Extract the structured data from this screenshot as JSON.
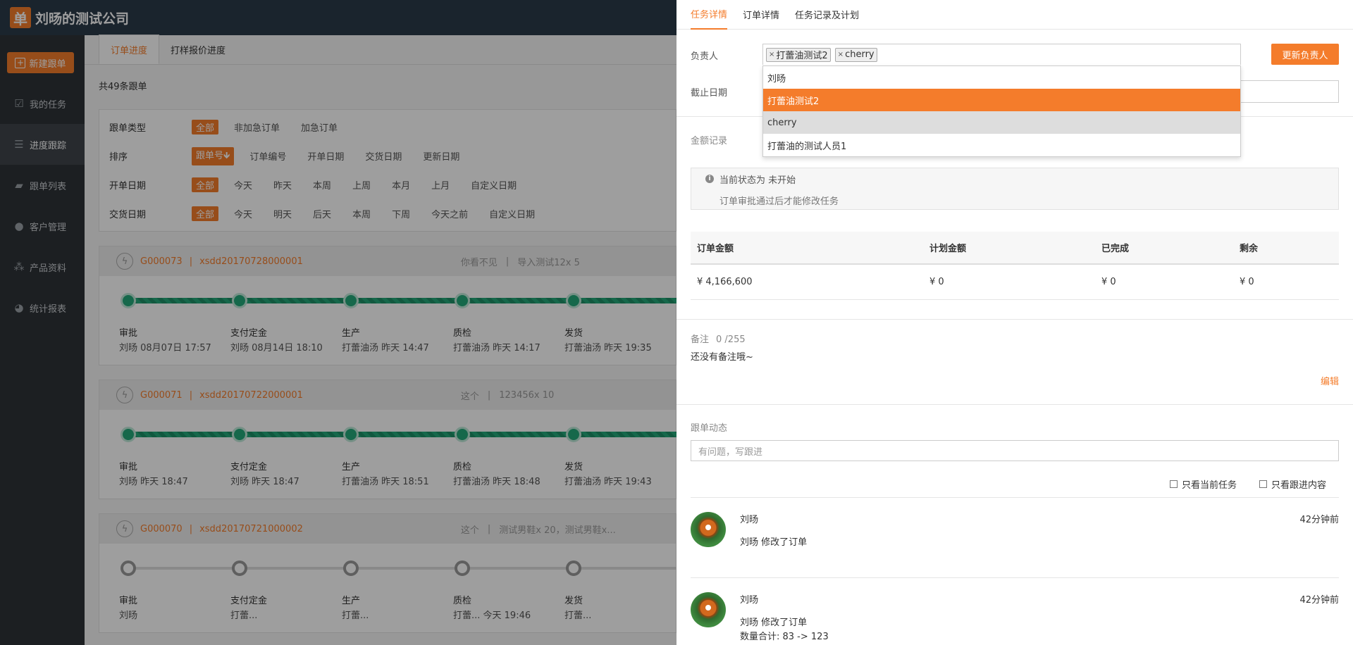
{
  "app": {
    "logo_char": "单",
    "company": "刘旸的测试公司"
  },
  "sidebar": {
    "new_button": "新建跟单",
    "items": [
      {
        "label": "我的任务",
        "icon": "check-icon"
      },
      {
        "label": "进度跟踪",
        "icon": "progress-icon",
        "active": true
      },
      {
        "label": "跟单列表",
        "icon": "folder-icon"
      },
      {
        "label": "客户管理",
        "icon": "user-icon"
      },
      {
        "label": "产品资料",
        "icon": "cubes-icon"
      },
      {
        "label": "统计报表",
        "icon": "pie-chart-icon"
      }
    ]
  },
  "main": {
    "tabs": [
      "订单进度",
      "打样报价进度"
    ],
    "count": "共49条跟单",
    "filters": [
      {
        "label": "跟单类型",
        "options": [
          "全部",
          "非加急订单",
          "加急订单"
        ]
      },
      {
        "label": "排序",
        "options": [
          "跟单号🡻",
          "订单编号",
          "开单日期",
          "交货日期",
          "更新日期"
        ]
      },
      {
        "label": "开单日期",
        "options": [
          "全部",
          "今天",
          "昨天",
          "本周",
          "上周",
          "本月",
          "上月",
          "自定义日期"
        ]
      },
      {
        "label": "交货日期",
        "options": [
          "全部",
          "今天",
          "明天",
          "后天",
          "本周",
          "下周",
          "今天之前",
          "自定义日期"
        ]
      }
    ],
    "orders": [
      {
        "id": "G000073",
        "number": "xsdd20170728000001",
        "name_a": "你看不见",
        "name_b": "导入测试12x 5",
        "done": true,
        "stages": [
          {
            "name": "审批",
            "info": "刘旸 08月07日 17:57"
          },
          {
            "name": "支付定金",
            "info": "刘旸 08月14日 18:10"
          },
          {
            "name": "生产",
            "info": "打蕾油汤 昨天 14:47"
          },
          {
            "name": "质检",
            "info": "打蕾油汤 昨天 14:17"
          },
          {
            "name": "发货",
            "info": "打蕾油汤 昨天 19:35"
          }
        ]
      },
      {
        "id": "G000071",
        "number": "xsdd20170722000001",
        "name_a": "这个",
        "name_b": "123456x 10",
        "done": true,
        "stages": [
          {
            "name": "审批",
            "info": "刘旸 昨天 18:47"
          },
          {
            "name": "支付定金",
            "info": "刘旸 昨天 18:47"
          },
          {
            "name": "生产",
            "info": "打蕾油汤 昨天 18:51"
          },
          {
            "name": "质检",
            "info": "打蕾油汤 昨天 18:48"
          },
          {
            "name": "发货",
            "info": "打蕾油汤 昨天 19:43"
          }
        ]
      },
      {
        "id": "G000070",
        "number": "xsdd20170721000002",
        "name_a": "这个",
        "name_b": "测试男鞋x 20，测试男鞋x...",
        "done": false,
        "stages": [
          {
            "name": "审批",
            "info": "刘旸"
          },
          {
            "name": "支付定金",
            "info": "打蕾..."
          },
          {
            "name": "生产",
            "info": "打蕾..."
          },
          {
            "name": "质检",
            "info": "打蕾...    今天 19:46"
          },
          {
            "name": "发货",
            "info": "打蕾..."
          }
        ]
      }
    ]
  },
  "panel": {
    "tabs": [
      "任务详情",
      "订单详情",
      "任务记录及计划"
    ],
    "assignee_label": "负责人",
    "tags": [
      "打蕾油测试2",
      "cherry"
    ],
    "update_button": "更新负责人",
    "dropdown_options": [
      "刘旸",
      "打蕾油测试2",
      "cherry",
      "打蕾油的测试人员1"
    ],
    "deadline_label": "截止日期",
    "amount_label": "金额记录",
    "status_line1": "当前状态为 未开始",
    "status_line2": "订单审批通过后才能修改任务",
    "money_headers": [
      "订单金额",
      "计划金额",
      "已完成",
      "剩余"
    ],
    "money_values": [
      "¥ 4,166,600",
      "¥ 0",
      "¥ 0",
      "¥ 0"
    ],
    "remark_label": "备注",
    "remark_count": "0 /255",
    "remark_text": "还没有备注哦~",
    "edit_link": "编辑",
    "dynamics_label": "跟单动态",
    "follow_placeholder": "有问题，写跟进",
    "checkbox_current": "只看当前任务",
    "checkbox_follow": "只看跟进内容",
    "activities": [
      {
        "user": "刘旸",
        "time": "42分钟前",
        "message": "刘旸 修改了订单",
        "detail": ""
      },
      {
        "user": "刘旸",
        "time": "42分钟前",
        "message": "刘旸 修改了订单",
        "detail": "数量合计: 83 -> 123"
      }
    ]
  }
}
